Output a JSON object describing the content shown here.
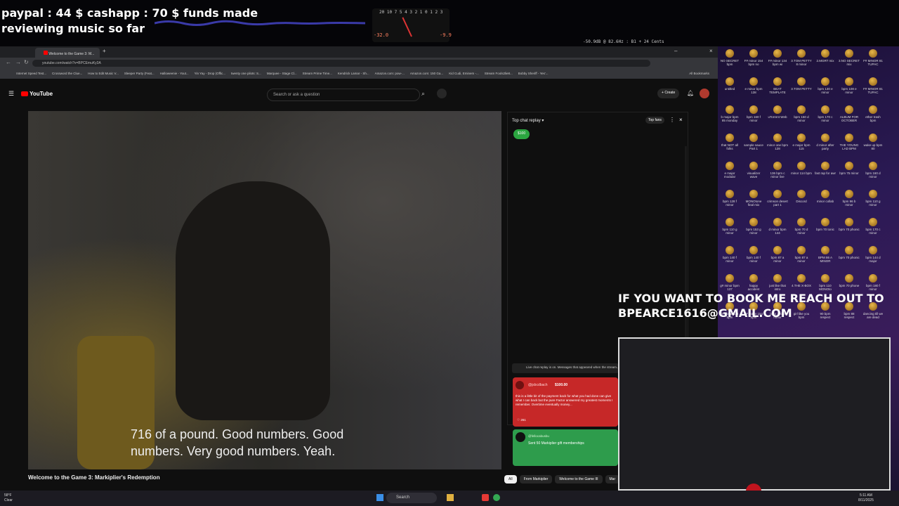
{
  "overlay": {
    "line1": "paypal : 44 $  cashapp : 70 $ funds made",
    "line2": "reviewing music so far",
    "meter_scale": "20 10 7 5 4 3 2 1 0  1  2  3",
    "meter_left": "-32.0",
    "meter_right": "-9.9",
    "eq_readout": "-50.9dB @ 82.6Hz : B1 + 24 Cents"
  },
  "browser": {
    "tab_title": "Welcome to the Game 3: M...",
    "url": "youtube.com/watch?v=BPCEmuKy3A",
    "bookmarks": [
      "Internet Speed Test...",
      "Crossword the Clue...",
      "How to Edit Music V...",
      "Sleeper Party (Feat...",
      "Halloweenie - Yout...",
      "Yin Yay - Drop (Offic...",
      "twenty one pilots: S...",
      "Marquee - Stage Cl...",
      "Stream Prime Time...",
      "Kendrick Lamar - Sh...",
      "Amazon.com: pow-...",
      "Amazon.com: 150 Ga...",
      "Kid Cudi, Eminem -...",
      "Stream Fools2lie8...",
      "Bobby Sheriff - Yes'..."
    ],
    "all_bookmarks": "All Bookmarks"
  },
  "youtube": {
    "logo": "YouTube",
    "search_placeholder": "Search or ask a question",
    "create": "Create",
    "caption_l1": "716 of a pound. Good numbers. Good",
    "caption_l2": "numbers. Very good numbers. Yeah.",
    "video_title": "Welcome to the Game 3: Markiplier's Redemption",
    "chat": {
      "header": "Top chat replay",
      "top_fans": "Top fans",
      "badge": "$100",
      "notice": "Live chat replay is on. Messages that appeared when the stream...",
      "sc_name": "@jsbcdbach",
      "sc_amount": "$100.00",
      "sc_body": "this is a little bit of the payment back for what you had done can give what I can back but the pure Factor answered my greatest moments I remember. Overtime eventually money...",
      "sc_likes": "261",
      "member_name": "@fellocabusbu",
      "member_body": "Sent 50 Markiplier gift memberships"
    },
    "chips": [
      "All",
      "From Markiplier",
      "Welcome to the Game III",
      "Mar"
    ]
  },
  "desktop": {
    "icons": [
      "NO SECRET bpm",
      "F# minor 154 bpm no",
      "F# minor 134 bpm wi",
      "3.TOM PETTY 8 minor",
      "2.MGRT mix",
      "3.NO SECRET mix",
      "F# MINOR 81 TUPAC",
      "untitled",
      "e minor bpm 138",
      "BEAT TEMPLATE",
      "3.TOM PETTY",
      "bpm 130 e minor",
      "bpm 108 e minor",
      "F# MINOR 81 TUPAC",
      "b major bpm 85 monday",
      "bpm 160 f minor",
      "uTorrent Web",
      "bpm 150 d minor",
      "bpm 170 c minor",
      "ALBUM FOR OCTOBER",
      "ether trash bpm",
      "that NOT all folks",
      "sample sauce Part 1",
      "minor one bpm 128",
      "e major bpm 115",
      "d minor after party",
      "THE YOUNG LAD BPM",
      "wake up bpm 80",
      "e major modular",
      "visualizer wave",
      "136 bpm c minor live",
      "minor 114 bpm",
      "fast rap for awr",
      "bpm 75 minor",
      "bpm 160 d minor",
      "bpm 128 f minor",
      "MONOtone final mix",
      "crimson desert part 1",
      "Discord",
      "minor collab",
      "bpm 96 b minor",
      "bpm 110 g minor",
      "bpm 110 g minor",
      "bpm 153 g minor",
      "d minor bpm 144",
      "bpm 70 d minor",
      "bpm 70 tonic",
      "bpm 70 phonic",
      "bpm 170 c minor",
      "bpm 140 f minor",
      "bpm 140 f minor",
      "bpm 87 a minor",
      "bpm 87 a minor",
      "BPM 86 A MINOR",
      "bpm 70 phonic",
      "bpm 144 d major",
      "g# minor bpm 137",
      "happy accident",
      "just like that intro",
      "4.THE X-BOX",
      "bpm 110 MONOto",
      "bpm 70 phone",
      "bpm 180 f minor",
      "f# minor 114 bpm",
      "c# minor 154 bpm",
      "bpm 120 b minor",
      "girl like you bpm",
      "90 bpm respect",
      "bpm 88 respect",
      "dancing till we are dead"
    ],
    "promo_l1": "IF YOU WANT TO BOOK ME REACH OUT TO",
    "promo_l2": "BPEARCE1616@GMAIL.COM"
  },
  "taskbar": {
    "weather": "58°F",
    "weather_sub": "Clear",
    "search": "Search",
    "time": "5:11 AM",
    "date": "8/11/2025"
  }
}
